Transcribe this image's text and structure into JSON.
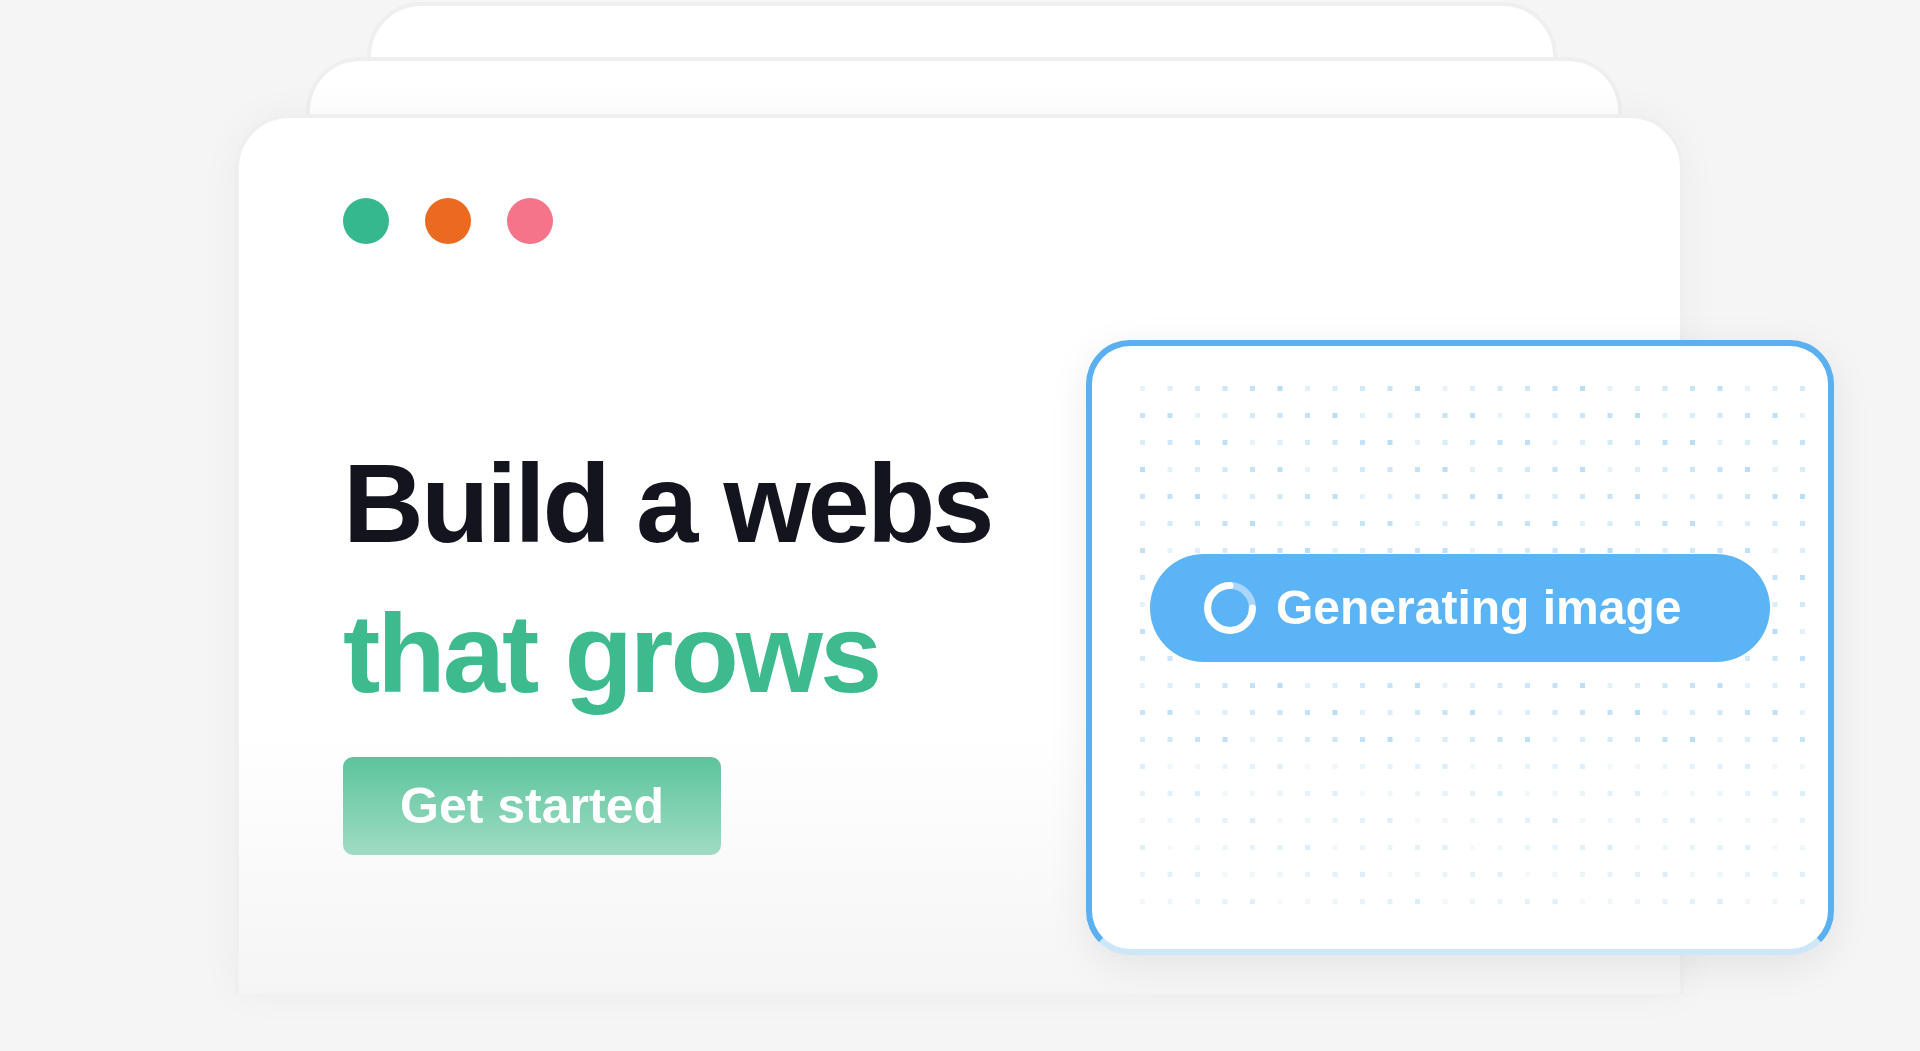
{
  "window_dots": [
    {
      "color": "#36b88f"
    },
    {
      "color": "#ec6a1f"
    },
    {
      "color": "#f57489"
    }
  ],
  "headline": {
    "line_1": "Build a webs",
    "line_2": "that grows"
  },
  "button": "Get started",
  "overlay": {
    "status": "Generating image"
  }
}
